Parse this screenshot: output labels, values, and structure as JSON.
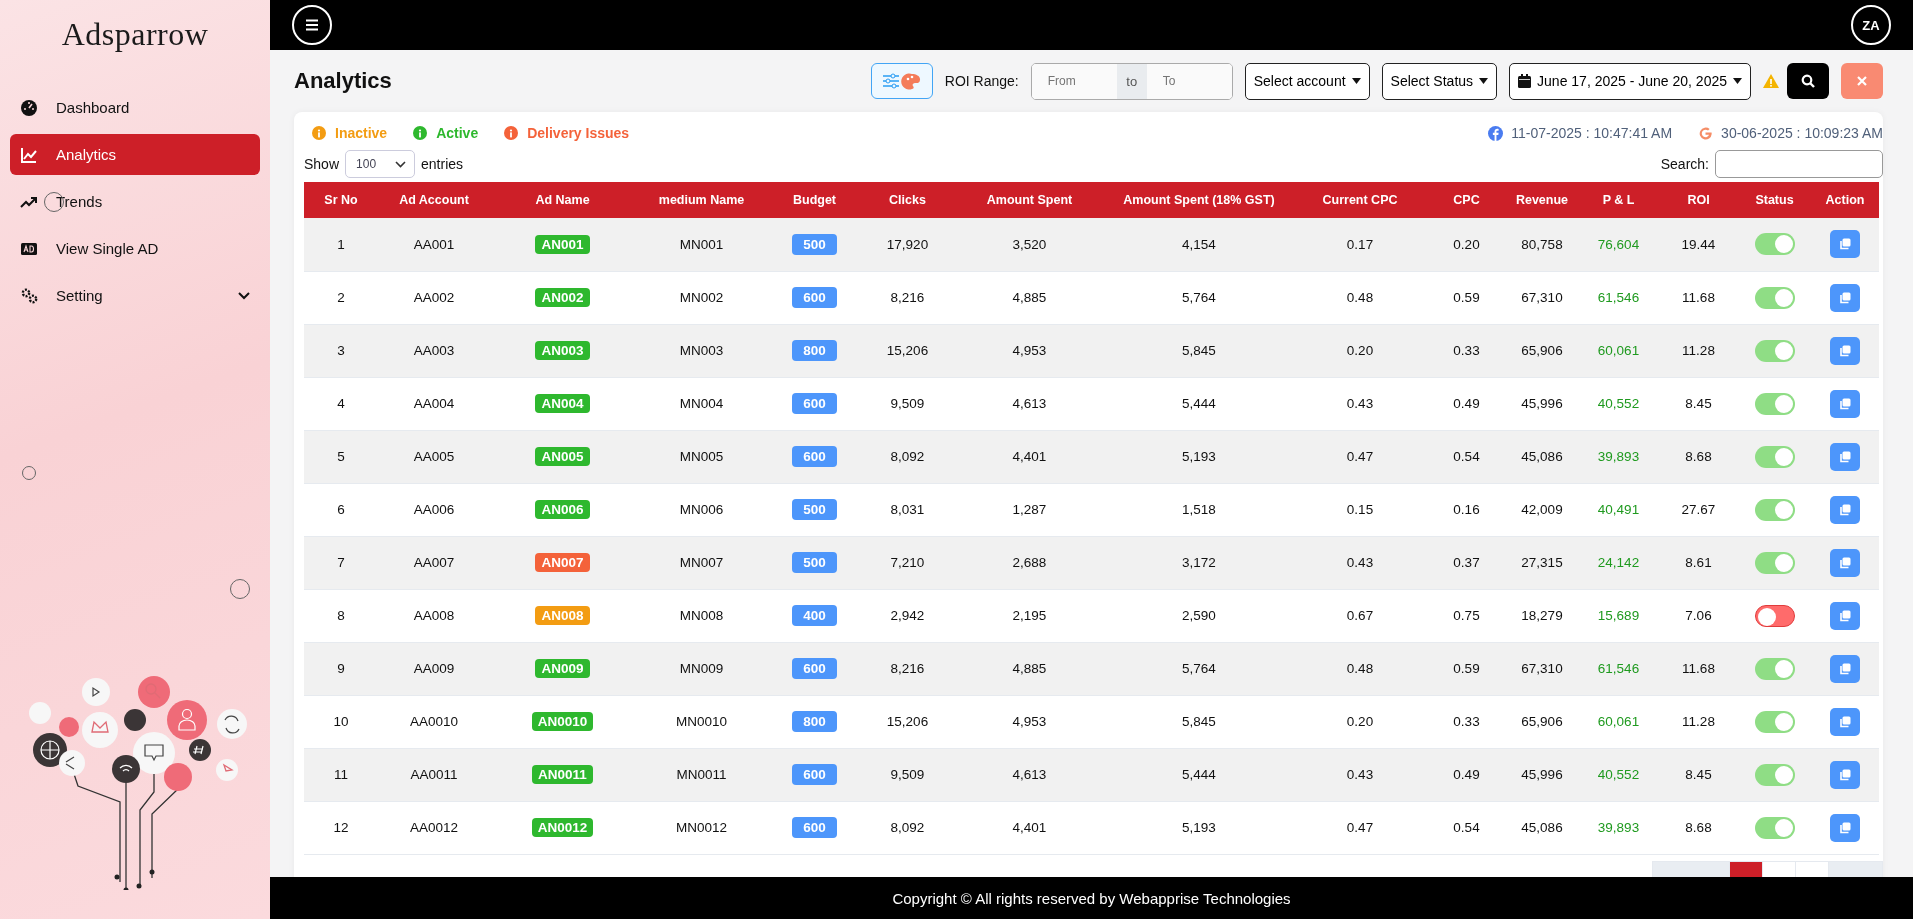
{
  "sidebar": {
    "logo": "Adsparrow",
    "items": [
      {
        "label": "Dashboard",
        "kind": "link",
        "selected": false
      },
      {
        "label": "Analytics",
        "kind": "link",
        "selected": true
      },
      {
        "label": "Trends",
        "kind": "link",
        "selected": false
      },
      {
        "label": "View Single AD",
        "kind": "link",
        "selected": false
      },
      {
        "label": "Setting",
        "kind": "group",
        "selected": false,
        "expanded": false
      }
    ]
  },
  "topbar": {
    "avatar": "ZA"
  },
  "page": {
    "title": "Analytics"
  },
  "toolbar": {
    "roi_label": "ROI Range:",
    "from_placeholder": "From",
    "to_text": "to",
    "to_placeholder": "To",
    "account_select": "Select account",
    "status_select": "Select Status",
    "date_range": "June 17, 2025 - June 20, 2025"
  },
  "legend": [
    {
      "label": "Inactive",
      "color": "#f39c12"
    },
    {
      "label": "Active",
      "color": "#2eb82e"
    },
    {
      "label": "Delivery Issues",
      "color": "#f4623a"
    }
  ],
  "sync_times": [
    {
      "text": "11-07-2025 : 10:47:41 AM"
    },
    {
      "text": "30-06-2025 : 10:09:23 AM"
    }
  ],
  "table_controls": {
    "show": "Show",
    "entries_value": "100",
    "entries": "entries",
    "search": "Search:"
  },
  "table": {
    "columns": [
      "Sr No",
      "Ad Account",
      "Ad Name",
      "medium Name",
      "Budget",
      "Clicks",
      "Amount Spent",
      "Amount Spent (18% GST)",
      "Current CPC",
      "CPC",
      "Revenue",
      "P & L",
      "ROI",
      "Status",
      "Action"
    ],
    "rows": [
      {
        "sr": "1",
        "account": "AA001",
        "ad_name": "AN001",
        "color": "#2eb82e",
        "medium": "MN001",
        "budget": "500",
        "clicks": "17,920",
        "spent": "3,520",
        "spent_gst": "4,154",
        "current_cpc": "0.17",
        "cpc": "0.20",
        "revenue": "80,758",
        "pl": "76,604",
        "roi": "19.44",
        "on": true
      },
      {
        "sr": "2",
        "account": "AA002",
        "ad_name": "AN002",
        "color": "#2eb82e",
        "medium": "MN002",
        "budget": "600",
        "clicks": "8,216",
        "spent": "4,885",
        "spent_gst": "5,764",
        "current_cpc": "0.48",
        "cpc": "0.59",
        "revenue": "67,310",
        "pl": "61,546",
        "roi": "11.68",
        "on": true
      },
      {
        "sr": "3",
        "account": "AA003",
        "ad_name": "AN003",
        "color": "#2eb82e",
        "medium": "MN003",
        "budget": "800",
        "clicks": "15,206",
        "spent": "4,953",
        "spent_gst": "5,845",
        "current_cpc": "0.20",
        "cpc": "0.33",
        "revenue": "65,906",
        "pl": "60,061",
        "roi": "11.28",
        "on": true
      },
      {
        "sr": "4",
        "account": "AA004",
        "ad_name": "AN004",
        "color": "#2eb82e",
        "medium": "MN004",
        "budget": "600",
        "clicks": "9,509",
        "spent": "4,613",
        "spent_gst": "5,444",
        "current_cpc": "0.43",
        "cpc": "0.49",
        "revenue": "45,996",
        "pl": "40,552",
        "roi": "8.45",
        "on": true
      },
      {
        "sr": "5",
        "account": "AA005",
        "ad_name": "AN005",
        "color": "#2eb82e",
        "medium": "MN005",
        "budget": "600",
        "clicks": "8,092",
        "spent": "4,401",
        "spent_gst": "5,193",
        "current_cpc": "0.47",
        "cpc": "0.54",
        "revenue": "45,086",
        "pl": "39,893",
        "roi": "8.68",
        "on": true
      },
      {
        "sr": "6",
        "account": "AA006",
        "ad_name": "AN006",
        "color": "#2eb82e",
        "medium": "MN006",
        "budget": "500",
        "clicks": "8,031",
        "spent": "1,287",
        "spent_gst": "1,518",
        "current_cpc": "0.15",
        "cpc": "0.16",
        "revenue": "42,009",
        "pl": "40,491",
        "roi": "27.67",
        "on": true
      },
      {
        "sr": "7",
        "account": "AA007",
        "ad_name": "AN007",
        "color": "#f4623a",
        "medium": "MN007",
        "budget": "500",
        "clicks": "7,210",
        "spent": "2,688",
        "spent_gst": "3,172",
        "current_cpc": "0.43",
        "cpc": "0.37",
        "revenue": "27,315",
        "pl": "24,142",
        "roi": "8.61",
        "on": true
      },
      {
        "sr": "8",
        "account": "AA008",
        "ad_name": "AN008",
        "color": "#f39c12",
        "medium": "MN008",
        "budget": "400",
        "clicks": "2,942",
        "spent": "2,195",
        "spent_gst": "2,590",
        "current_cpc": "0.67",
        "cpc": "0.75",
        "revenue": "18,279",
        "pl": "15,689",
        "roi": "7.06",
        "on": false
      },
      {
        "sr": "9",
        "account": "AA009",
        "ad_name": "AN009",
        "color": "#2eb82e",
        "medium": "MN009",
        "budget": "600",
        "clicks": "8,216",
        "spent": "4,885",
        "spent_gst": "5,764",
        "current_cpc": "0.48",
        "cpc": "0.59",
        "revenue": "67,310",
        "pl": "61,546",
        "roi": "11.68",
        "on": true
      },
      {
        "sr": "10",
        "account": "AA0010",
        "ad_name": "AN0010",
        "color": "#2eb82e",
        "medium": "MN0010",
        "budget": "800",
        "clicks": "15,206",
        "spent": "4,953",
        "spent_gst": "5,845",
        "current_cpc": "0.20",
        "cpc": "0.33",
        "revenue": "65,906",
        "pl": "60,061",
        "roi": "11.28",
        "on": true
      },
      {
        "sr": "11",
        "account": "AA0011",
        "ad_name": "AN0011",
        "color": "#2eb82e",
        "medium": "MN0011",
        "budget": "600",
        "clicks": "9,509",
        "spent": "4,613",
        "spent_gst": "5,444",
        "current_cpc": "0.43",
        "cpc": "0.49",
        "revenue": "45,996",
        "pl": "40,552",
        "roi": "8.45",
        "on": true
      },
      {
        "sr": "12",
        "account": "AA0012",
        "ad_name": "AN0012",
        "color": "#2eb82e",
        "medium": "MN0012",
        "budget": "600",
        "clicks": "8,092",
        "spent": "4,401",
        "spent_gst": "5,193",
        "current_cpc": "0.47",
        "cpc": "0.54",
        "revenue": "45,086",
        "pl": "39,893",
        "roi": "8.68",
        "on": true
      }
    ]
  },
  "pagination": [
    {
      "kind": "wide",
      "selected": false
    },
    {
      "kind": "page",
      "selected": true
    },
    {
      "kind": "page",
      "selected": false
    },
    {
      "kind": "page",
      "selected": false
    },
    {
      "kind": "wide",
      "selected": false
    }
  ],
  "footer": {
    "text": "Copyright © All rights reserved by Webapprise Technologies"
  }
}
